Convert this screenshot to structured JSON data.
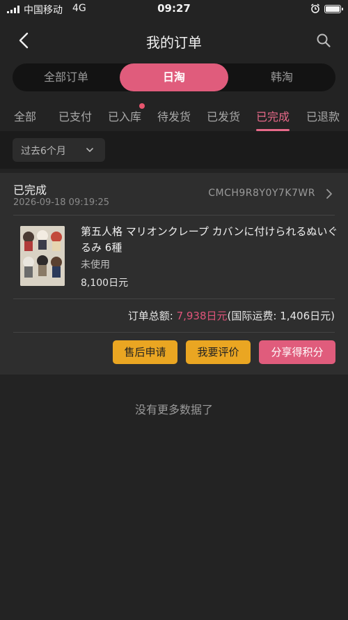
{
  "status_bar": {
    "carrier": "中国移动",
    "network": "4G",
    "time": "09:27"
  },
  "navbar": {
    "title": "我的订单"
  },
  "segments": [
    {
      "label": "全部订单",
      "active": false
    },
    {
      "label": "日淘",
      "active": true
    },
    {
      "label": "韩淘",
      "active": false
    }
  ],
  "tabs": [
    {
      "label": "全部",
      "active": false
    },
    {
      "label": "已支付",
      "active": false
    },
    {
      "label": "已入库",
      "active": false,
      "badge": true
    },
    {
      "label": "待发货",
      "active": false
    },
    {
      "label": "已发货",
      "active": false
    },
    {
      "label": "已完成",
      "active": true
    },
    {
      "label": "已退款",
      "active": false
    }
  ],
  "filter": {
    "label": "过去6个月"
  },
  "order": {
    "status": "已完成",
    "date": "2026-09-18 09:19:25",
    "order_no": "CMCH9R8Y0Y7K7WR",
    "product": {
      "name": "第五人格 マリオンクレープ カバンに付けられるぬいぐるみ 6種",
      "condition": "未使用",
      "price": "8,100日元"
    },
    "total": {
      "label": "订单总额:",
      "amount": "7,938日元",
      "shipping": "(国际运费: 1,406日元)"
    },
    "buttons": [
      {
        "label": "售后申请",
        "style": "yellow"
      },
      {
        "label": "我要评价",
        "style": "yellow"
      },
      {
        "label": "分享得积分",
        "style": "pink"
      }
    ]
  },
  "footer": {
    "no_more": "没有更多数据了"
  },
  "colors": {
    "accent_pink": "#e05c7c",
    "button_yellow": "#eaa622",
    "background": "#232323"
  }
}
